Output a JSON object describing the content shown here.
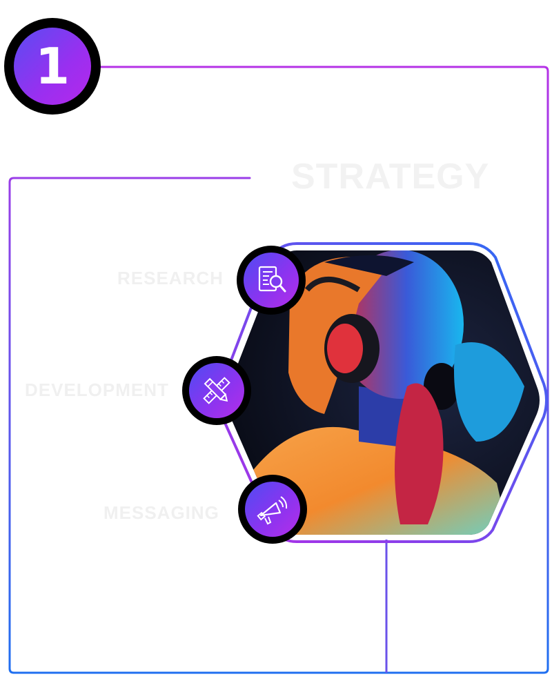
{
  "step": {
    "number": "1"
  },
  "title": "STRATEGY",
  "services": [
    {
      "label": "RESEARCH",
      "icon": "research-document-search-icon"
    },
    {
      "label": "DEVELOPMENT",
      "icon": "pencil-ruler-icon"
    },
    {
      "label": "MESSAGING",
      "icon": "megaphone-icon"
    }
  ],
  "colors": {
    "accent_purple": "#b532e6",
    "accent_blue": "#1f6ff0",
    "badge_ring": "#000000"
  }
}
